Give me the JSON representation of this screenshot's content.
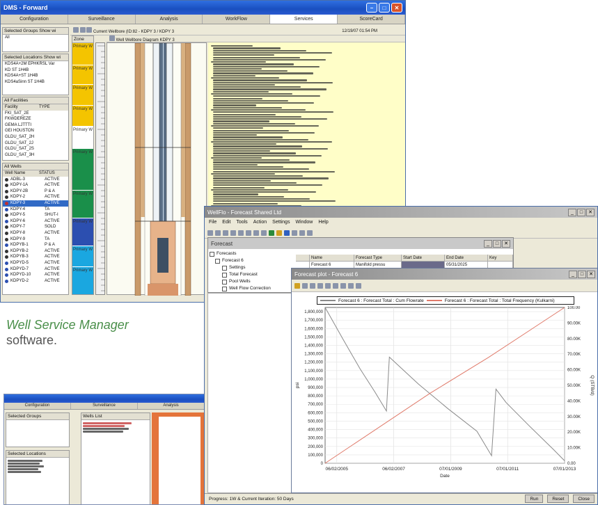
{
  "colors": {
    "yellow_zone": "#f4c400",
    "green_zone": "#1a8f4a",
    "blue_zone": "#2c4fb0",
    "cyan_zone": "#1aa7e0",
    "pressure_series": "#8a8a8a",
    "volume_series": "#e07a6a",
    "caption_green": "#4a8f4a"
  },
  "caption": {
    "line1": "Well Service Manager",
    "line2": "software."
  },
  "main_window": {
    "title": "DMS - Forward",
    "tabs": [
      {
        "label": "Configuration"
      },
      {
        "label": "Surveillance"
      },
      {
        "label": "Analysis"
      },
      {
        "label": "WorkFlow"
      },
      {
        "label": "Services"
      },
      {
        "label": "ScoreCard"
      }
    ],
    "selected_tab": "Services",
    "toolbar_text": "Current Wellbore (ID:82 - KDPY 3 / KDPY 3",
    "toolbar_text_right": "Well Wellbore Diagram  KDPY 3",
    "toolbar_date": "12/19/07 01:54 PM",
    "panel_groups_header": "Selected Groups",
    "panel_groups_show": "Show wi",
    "panel_groups_item": "All",
    "panel_locations_header": "Selected Locations",
    "panel_locations_show": "Show wi",
    "locations": [
      {
        "name": "KDS4A+2M EPHKRSL Var"
      },
      {
        "name": "KD ST 1H4B"
      },
      {
        "name": "KDS4A+ST 1H4B"
      },
      {
        "name": "KDS4aSinn ST 1H4B"
      }
    ],
    "facilities_header": "All Facilities",
    "facilities_cols": [
      "Facility",
      "TYPE"
    ],
    "facilities": [
      {
        "name": "FKI_SAT_2E"
      },
      {
        "name": "FKWDEREZE"
      },
      {
        "name": "GEMA LJTTTI"
      },
      {
        "name": "GEI HOUSTON"
      },
      {
        "name": "GLDU_SAT_2H"
      },
      {
        "name": "GLDU_SAT_2J"
      },
      {
        "name": "GLDU_SAT_2S"
      },
      {
        "name": "GLDU_SAT_3H"
      }
    ],
    "wells_header": "All Wells",
    "wells_cols": [
      "Well Name",
      "STATUS"
    ],
    "wells": [
      {
        "name": "ADBL-3",
        "status": "ACTIVE"
      },
      {
        "name": "KDPY-1A",
        "status": "ACTIVE"
      },
      {
        "name": "KDPY-2B",
        "status": "P & A"
      },
      {
        "name": "KDPY-2",
        "status": "ACTIVE"
      },
      {
        "name": "KDPY-3",
        "status": "ACTIVE"
      },
      {
        "name": "KDPY-4",
        "status": "TA"
      },
      {
        "name": "KDPY-5",
        "status": "SHUT-I"
      },
      {
        "name": "KDPY-6",
        "status": "ACTIVE"
      },
      {
        "name": "KDPY-7",
        "status": "SOLD"
      },
      {
        "name": "KDPY-8",
        "status": "ACTIVE"
      },
      {
        "name": "KDPY-9",
        "status": "TA"
      },
      {
        "name": "KDPYB-1",
        "status": "P & A"
      },
      {
        "name": "KDPYB-2",
        "status": "ACTIVE"
      },
      {
        "name": "KDPYB-3",
        "status": "ACTIVE"
      },
      {
        "name": "KDPYD-5",
        "status": "ACTIVE"
      },
      {
        "name": "KDPYD-7",
        "status": "ACTIVE"
      },
      {
        "name": "KDPYD-10",
        "status": "ACTIVE"
      },
      {
        "name": "KDPYD-2",
        "status": "ACTIVE"
      }
    ],
    "zones_header": "Zone",
    "zone_label": "Primary W"
  },
  "forecast_window": {
    "title": "WellFlo - Forecast Shared Ltd",
    "menu": [
      "File",
      "Edit",
      "Tools",
      "Action",
      "Settings",
      "Window",
      "Help"
    ],
    "sub_title": "Forecast",
    "grid_cols": [
      "Name",
      "Forecast Type",
      "Start Date",
      "End Date",
      "Key"
    ],
    "grid_row": [
      "Forecast 6",
      "Manifold pressu",
      "",
      "05/31/2025",
      ""
    ],
    "tree": [
      {
        "label": "Forecasts"
      },
      {
        "label": "Forecast 6"
      },
      {
        "label": "Settings"
      },
      {
        "label": "Total Forecast"
      },
      {
        "label": "Pool Wells"
      },
      {
        "label": "Well Flow Correction"
      }
    ],
    "plot_title": "Forecast plot - Forecast 6",
    "legend": [
      "Forecast 6 : Forecast Total : Cum Flowrate",
      "Forecast 6 : Forecast Total : Total Frequency (Kulkarni)"
    ],
    "status_text": "Progress: 1W & Current Iteration: 50 Days",
    "buttons": {
      "run": "Run",
      "reset": "Reset",
      "close": "Close"
    }
  },
  "bottom_window": {
    "tabs": [
      {
        "label": "Configuration"
      },
      {
        "label": "Surveillance"
      },
      {
        "label": "Analysis"
      }
    ],
    "left_header": "Selected Groups",
    "left_header2": "Selected Locations",
    "list_header": "Wells List"
  },
  "chart_data": {
    "type": "line",
    "title": "",
    "xlabel": "Date",
    "ylabel_left": "psi",
    "ylabel_right": "Q (STB/d)",
    "x_ticks": [
      "06/02/2005",
      "06/02/2007",
      "07/01/2009",
      "07/01/2011",
      "07/01/2013"
    ],
    "y_left_ticks": [
      0,
      100000,
      200000,
      300000,
      400000,
      500000,
      600000,
      700000,
      800000,
      900000,
      1000000,
      1100000,
      1200000,
      1300000,
      1400000,
      1500000,
      1600000,
      1700000,
      1800000
    ],
    "y_left_labels": [
      "0",
      "100,000",
      "200,000",
      "300,000",
      "400,000",
      "500,000",
      "600,000",
      "700,000",
      "800,000",
      "900,000",
      "1,000,000",
      "1,100,000",
      "1,200,000",
      "1,300,000",
      "1,400,000",
      "1,500,000",
      "1,600,000",
      "1,700,000",
      "1,800,000"
    ],
    "y_right_ticks": [
      0,
      10000,
      20000,
      30000,
      40000,
      50000,
      60000,
      70000,
      80000,
      90000,
      100000
    ],
    "y_right_labels": [
      "0.00",
      "10.00K",
      "20.00K",
      "30.00K",
      "40.00K",
      "50.00K",
      "60.00K",
      "70.00K",
      "80.00K",
      "90.00K",
      "100.00"
    ],
    "xlim": [
      2005.4,
      2013.6
    ],
    "ylim_left": [
      0,
      1850000
    ],
    "ylim_right": [
      0,
      100000
    ],
    "grid": true,
    "series": [
      {
        "axis": "left",
        "x": [
          2005.4,
          2006.0,
          2006.6,
          2007.1,
          2007.5,
          2007.6,
          2008.6,
          2009.6,
          2010.6,
          2011.1,
          2011.25,
          2011.6,
          2012.4,
          2013.2,
          2013.6
        ],
        "y": [
          1850000,
          1480000,
          1120000,
          850000,
          620000,
          1260000,
          940000,
          650000,
          380000,
          90000,
          880000,
          720000,
          440000,
          170000,
          30000
        ]
      },
      {
        "axis": "right",
        "x": [
          2005.4,
          2007.0,
          2009.0,
          2011.0,
          2013.6
        ],
        "y": [
          0,
          20000,
          45000,
          68000,
          100000
        ]
      }
    ]
  }
}
